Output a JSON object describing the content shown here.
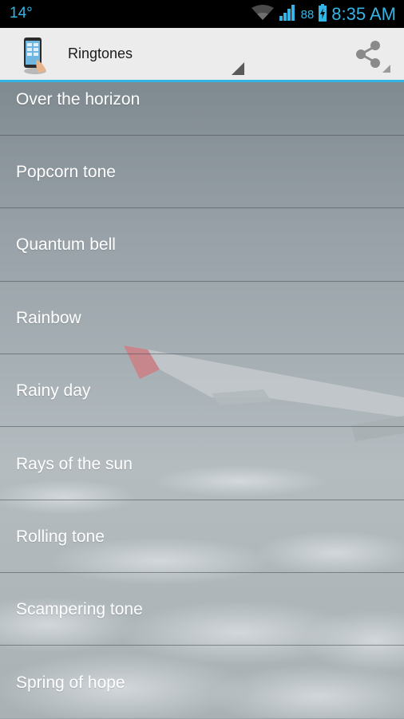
{
  "status_bar": {
    "temperature": "14°",
    "battery_percent": "88",
    "time": "8:35 AM"
  },
  "action_bar": {
    "spinner_label": "Ringtones",
    "icons": {
      "app": "phone-app-icon",
      "spinner": "spinner-arrow-icon",
      "share": "share-icon"
    }
  },
  "ringtones": [
    "Over the horizon",
    "Popcorn tone",
    "Quantum bell",
    "Rainbow",
    "Rainy day",
    "Rays of the sun",
    "Rolling tone",
    "Scampering tone",
    "Spring of hope"
  ],
  "colors": {
    "accent": "#33b5e5",
    "action_bar_bg": "#ececec",
    "status_bar_bg": "#000000",
    "list_text": "#ffffff"
  }
}
